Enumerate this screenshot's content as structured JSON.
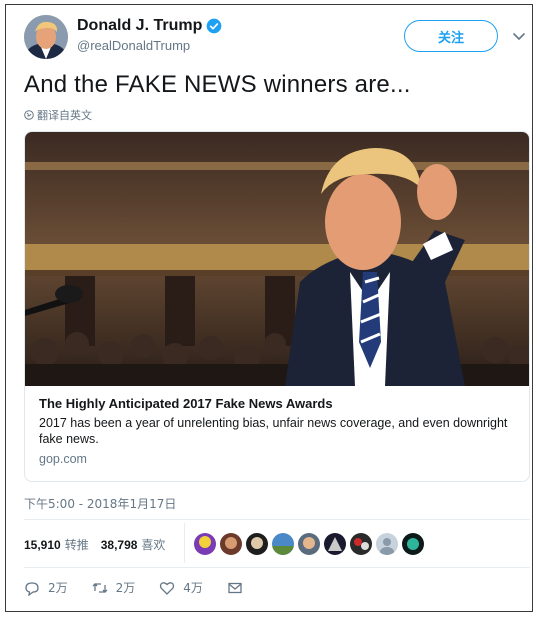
{
  "author": {
    "display_name": "Donald J. Trump",
    "handle": "@realDonaldTrump",
    "verified_icon": "verified-badge-icon"
  },
  "follow_label": "关注",
  "tweet": {
    "text": "And the FAKE NEWS winners are...",
    "translate_label": "翻译自英文"
  },
  "card": {
    "title": "The Highly Anticipated 2017 Fake News Awards",
    "description": "2017 has been a year of unrelenting bias, unfair news coverage, and even downright fake news.",
    "domain": "gop.com"
  },
  "timestamp": "下午5:00 - 2018年1月17日",
  "stats": {
    "retweets_count": "15,910",
    "retweets_label": "转推",
    "likes_count": "38,798",
    "likes_label": "喜欢"
  },
  "actions": {
    "reply_count": "2万",
    "retweet_count": "2万",
    "like_count": "4万"
  },
  "colors": {
    "accent": "#1da1f2",
    "muted": "#657786",
    "text": "#14171a"
  }
}
